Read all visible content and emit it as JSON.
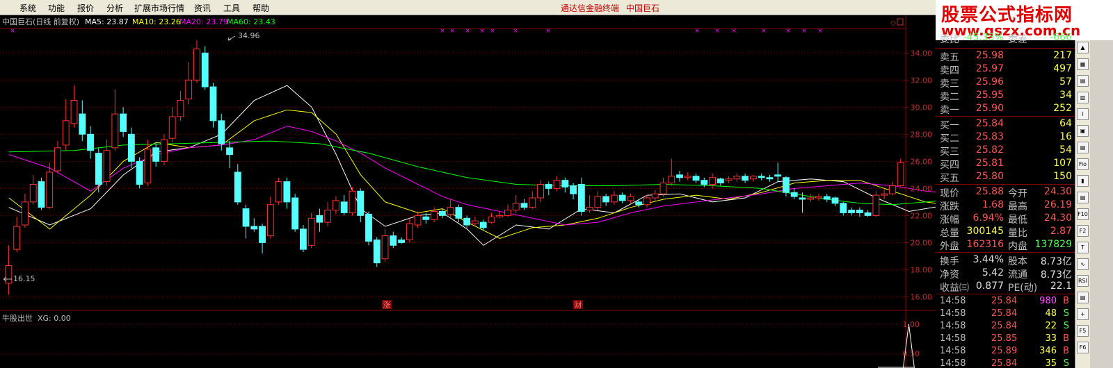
{
  "menu": {
    "items": [
      "系统",
      "功能",
      "报价",
      "分析",
      "扩展市场行情",
      "资讯",
      "工具",
      "帮助"
    ],
    "app_title": "通达信金融终端",
    "stock_title": "中国巨石"
  },
  "watermark": {
    "main": "股票公式指标网",
    "url": "www.gszx.com.cn"
  },
  "main_chart": {
    "header": {
      "name": "中国巨石(日线 前复权)",
      "ma5": "MA5: 23.87",
      "ma10": "MA10: 23.26",
      "ma20": "MA20: 23.79",
      "ma60": "MA60: 23.43"
    },
    "high_label": "34.96",
    "low_label": "16.15",
    "event_markers": [
      "涨",
      "财"
    ],
    "colors": {
      "up": "#ff3232",
      "down": "#54ffff",
      "ma5": "#ffffff",
      "ma10": "#ffff00",
      "ma20": "#ff00ff",
      "ma60": "#00ff00",
      "grid": "#8b0000",
      "axis_text": "#c03030"
    }
  },
  "indicator": {
    "title": "牛股出世",
    "value": "XG: 0.00",
    "axis": [
      "1.00",
      "0.50"
    ]
  },
  "chart_data": {
    "type": "candlestick",
    "title": "中国巨石(日线 前复权)",
    "y_ticks": [
      16.0,
      18.0,
      20.0,
      22.0,
      24.0,
      26.0,
      28.0,
      30.0,
      32.0,
      34.0
    ],
    "y_tick_labels": [
      "16.00",
      "18.00",
      "20.00",
      "22.00",
      "24.00",
      "26.00",
      "28.00",
      "30.00",
      "32.00",
      "34.00"
    ],
    "ylim": [
      15.2,
      35.4
    ],
    "candles": [
      [
        17.0,
        18.3,
        16.15,
        19.8
      ],
      [
        19.5,
        21.2,
        19.3,
        21.9
      ],
      [
        21.3,
        23.0,
        21.1,
        23.6
      ],
      [
        23.0,
        24.3,
        22.8,
        25.0
      ],
      [
        24.5,
        22.6,
        22.4,
        24.8
      ],
      [
        22.6,
        25.2,
        22.5,
        25.9
      ],
      [
        25.3,
        27.0,
        25.1,
        27.5
      ],
      [
        27.2,
        29.0,
        26.8,
        30.6
      ],
      [
        28.8,
        30.5,
        28.5,
        31.6
      ],
      [
        29.5,
        28.0,
        27.5,
        30.5
      ],
      [
        28.0,
        26.8,
        26.2,
        28.6
      ],
      [
        26.6,
        24.3,
        23.7,
        27.0
      ],
      [
        24.5,
        26.8,
        24.2,
        27.6
      ],
      [
        27.0,
        29.5,
        26.8,
        31.3
      ],
      [
        29.5,
        28.2,
        27.8,
        30.0
      ],
      [
        28.0,
        26.0,
        25.5,
        28.5
      ],
      [
        26.0,
        24.3,
        24.0,
        26.3
      ],
      [
        24.4,
        26.9,
        24.2,
        27.6
      ],
      [
        27.0,
        26.0,
        25.6,
        27.4
      ],
      [
        26.0,
        27.6,
        25.7,
        28.0
      ],
      [
        27.7,
        29.3,
        27.4,
        30.0
      ],
      [
        29.3,
        30.5,
        29.0,
        31.2
      ],
      [
        30.6,
        32.0,
        30.2,
        33.3
      ],
      [
        32.0,
        34.3,
        31.8,
        34.96
      ],
      [
        34.0,
        31.5,
        31.3,
        34.5
      ],
      [
        31.5,
        29.0,
        28.5,
        31.8
      ],
      [
        29.0,
        27.3,
        26.8,
        29.5
      ],
      [
        27.0,
        26.5,
        25.5,
        27.5
      ],
      [
        25.2,
        23.0,
        22.8,
        25.8
      ],
      [
        22.5,
        21.2,
        20.3,
        22.8
      ],
      [
        21.2,
        21.0,
        20.8,
        21.8
      ],
      [
        21.2,
        20.0,
        19.2,
        21.4
      ],
      [
        20.5,
        22.8,
        20.3,
        23.4
      ],
      [
        23.0,
        24.5,
        22.8,
        24.8
      ],
      [
        24.5,
        23.0,
        22.5,
        24.8
      ],
      [
        23.3,
        21.0,
        20.8,
        23.6
      ],
      [
        21.0,
        19.5,
        19.3,
        21.3
      ],
      [
        19.8,
        21.8,
        19.6,
        22.2
      ],
      [
        22.0,
        21.5,
        20.8,
        22.5
      ],
      [
        21.5,
        22.4,
        21.2,
        23.0
      ],
      [
        22.4,
        23.1,
        22.1,
        23.4
      ],
      [
        23.0,
        22.2,
        22.0,
        23.5
      ],
      [
        22.2,
        23.8,
        22.0,
        24.1
      ],
      [
        23.8,
        22.0,
        21.5,
        24.0
      ],
      [
        22.1,
        20.1,
        19.8,
        22.3
      ],
      [
        20.2,
        18.5,
        18.2,
        20.4
      ],
      [
        18.8,
        20.5,
        18.6,
        21.0
      ],
      [
        20.5,
        19.8,
        19.6,
        20.8
      ],
      [
        20.2,
        20.0,
        19.9,
        20.4
      ],
      [
        20.2,
        21.4,
        20.0,
        21.8
      ],
      [
        21.3,
        22.0,
        21.1,
        22.3
      ],
      [
        21.9,
        21.7,
        21.4,
        22.2
      ],
      [
        21.7,
        22.3,
        21.5,
        22.6
      ],
      [
        22.3,
        22.0,
        21.8,
        22.5
      ],
      [
        22.1,
        22.6,
        21.9,
        23.2
      ],
      [
        22.6,
        21.8,
        21.5,
        22.8
      ],
      [
        21.8,
        21.3,
        21.1,
        22.0
      ],
      [
        21.4,
        21.6,
        21.2,
        21.9
      ],
      [
        21.5,
        21.1,
        20.9,
        21.7
      ],
      [
        21.5,
        21.9,
        21.4,
        22.2
      ],
      [
        21.9,
        22.0,
        21.8,
        22.3
      ],
      [
        22.0,
        22.4,
        21.9,
        22.8
      ],
      [
        22.4,
        22.9,
        22.2,
        23.5
      ],
      [
        22.9,
        22.6,
        22.4,
        23.2
      ],
      [
        22.6,
        23.3,
        22.5,
        23.8
      ],
      [
        23.3,
        24.3,
        23.0,
        24.6
      ],
      [
        24.3,
        24.0,
        23.5,
        24.5
      ],
      [
        24.0,
        24.6,
        23.8,
        24.9
      ],
      [
        24.6,
        24.1,
        23.7,
        24.8
      ],
      [
        24.2,
        23.6,
        23.2,
        24.4
      ],
      [
        24.3,
        22.3,
        22.0,
        24.8
      ],
      [
        22.4,
        22.6,
        22.2,
        23.5
      ],
      [
        22.6,
        23.4,
        22.4,
        23.8
      ],
      [
        23.4,
        23.0,
        22.7,
        23.6
      ],
      [
        23.0,
        23.5,
        22.8,
        23.8
      ],
      [
        23.5,
        23.1,
        22.9,
        23.7
      ],
      [
        23.1,
        23.4,
        22.9,
        23.6
      ],
      [
        23.0,
        22.8,
        22.6,
        23.2
      ],
      [
        22.8,
        23.3,
        22.6,
        23.5
      ],
      [
        23.3,
        23.6,
        23.1,
        23.9
      ],
      [
        23.6,
        24.4,
        23.4,
        24.8
      ],
      [
        24.4,
        24.9,
        24.2,
        26.2
      ],
      [
        25.0,
        24.8,
        24.5,
        25.3
      ],
      [
        24.8,
        24.9,
        24.6,
        25.2
      ],
      [
        24.9,
        24.6,
        24.4,
        25.1
      ],
      [
        24.6,
        24.3,
        24.1,
        24.8
      ],
      [
        24.3,
        24.8,
        24.0,
        25.1
      ],
      [
        24.7,
        24.4,
        24.2,
        24.8
      ],
      [
        24.6,
        24.7,
        24.4,
        24.9
      ],
      [
        24.7,
        24.9,
        24.5,
        25.1
      ],
      [
        24.9,
        24.6,
        24.4,
        25.1
      ],
      [
        24.7,
        24.9,
        24.5,
        25.0
      ],
      [
        24.9,
        24.8,
        24.6,
        25.1
      ],
      [
        24.8,
        24.7,
        24.5,
        25.0
      ],
      [
        25.0,
        24.9,
        24.5,
        25.9
      ],
      [
        24.8,
        23.7,
        23.4,
        24.9
      ],
      [
        23.7,
        23.4,
        23.2,
        24.0
      ],
      [
        23.3,
        23.2,
        22.2,
        23.7
      ],
      [
        23.2,
        23.3,
        23.0,
        23.6
      ],
      [
        23.3,
        23.4,
        23.1,
        23.6
      ],
      [
        23.4,
        23.2,
        23.0,
        23.6
      ],
      [
        23.3,
        22.9,
        22.7,
        23.4
      ],
      [
        22.9,
        22.2,
        22.0,
        23.0
      ],
      [
        22.4,
        22.2,
        22.0,
        22.6
      ],
      [
        22.4,
        22.2,
        21.9,
        22.6
      ],
      [
        22.2,
        22.0,
        21.9,
        22.4
      ],
      [
        22.0,
        23.5,
        21.9,
        23.8
      ],
      [
        23.5,
        23.6,
        23.2,
        24.0
      ],
      [
        23.6,
        24.2,
        23.5,
        24.5
      ],
      [
        24.2,
        25.9,
        24.1,
        26.19
      ]
    ],
    "ma_series": [
      {
        "name": "MA5",
        "color": "#ffffff",
        "points": [
          [
            0,
            22.6
          ],
          [
            5,
            21.3
          ],
          [
            10,
            22.5
          ],
          [
            14,
            25.0
          ],
          [
            18,
            26.7
          ],
          [
            22,
            27.0
          ],
          [
            26,
            28.0
          ],
          [
            30,
            30.5
          ],
          [
            34,
            31.6
          ],
          [
            37,
            30.0
          ],
          [
            40,
            26.5
          ],
          [
            43,
            22.5
          ],
          [
            46,
            21.2
          ],
          [
            50,
            22.0
          ],
          [
            53,
            22.2
          ],
          [
            56,
            21.0
          ],
          [
            58,
            19.8
          ],
          [
            62,
            21.3
          ],
          [
            66,
            21.0
          ],
          [
            70,
            22.5
          ],
          [
            74,
            22.2
          ],
          [
            78,
            23.5
          ],
          [
            82,
            23.6
          ],
          [
            86,
            23.0
          ],
          [
            90,
            23.3
          ],
          [
            94,
            24.5
          ],
          [
            98,
            24.7
          ],
          [
            102,
            24.5
          ],
          [
            106,
            23.3
          ],
          [
            110,
            22.3
          ],
          [
            114,
            22.7
          ],
          [
            118,
            23.1
          ]
        ]
      },
      {
        "name": "MA10",
        "color": "#ffff00",
        "points": [
          [
            0,
            23.3
          ],
          [
            5,
            21.0
          ],
          [
            10,
            23.5
          ],
          [
            14,
            26.0
          ],
          [
            18,
            27.4
          ],
          [
            22,
            27.0
          ],
          [
            26,
            27.2
          ],
          [
            30,
            29.0
          ],
          [
            34,
            29.8
          ],
          [
            37,
            29.6
          ],
          [
            40,
            28.0
          ],
          [
            43,
            25.0
          ],
          [
            46,
            23.0
          ],
          [
            50,
            22.2
          ],
          [
            53,
            22.5
          ],
          [
            56,
            21.5
          ],
          [
            60,
            20.3
          ],
          [
            64,
            21.1
          ],
          [
            68,
            21.3
          ],
          [
            72,
            21.8
          ],
          [
            76,
            22.6
          ],
          [
            80,
            23.2
          ],
          [
            84,
            23.5
          ],
          [
            88,
            23.2
          ],
          [
            92,
            23.7
          ],
          [
            96,
            24.4
          ],
          [
            100,
            24.6
          ],
          [
            104,
            24.6
          ],
          [
            108,
            23.8
          ],
          [
            112,
            23.0
          ],
          [
            116,
            22.7
          ],
          [
            118,
            23.26
          ]
        ]
      },
      {
        "name": "MA20",
        "color": "#ff00ff",
        "points": [
          [
            0,
            26.5
          ],
          [
            5,
            25.5
          ],
          [
            10,
            23.8
          ],
          [
            14,
            25.5
          ],
          [
            18,
            26.5
          ],
          [
            22,
            27.0
          ],
          [
            26,
            27.2
          ],
          [
            30,
            27.6
          ],
          [
            34,
            28.6
          ],
          [
            37,
            28.2
          ],
          [
            40,
            27.5
          ],
          [
            43,
            26.6
          ],
          [
            46,
            25.5
          ],
          [
            50,
            24.3
          ],
          [
            53,
            23.4
          ],
          [
            56,
            22.8
          ],
          [
            60,
            22.3
          ],
          [
            64,
            21.8
          ],
          [
            68,
            21.3
          ],
          [
            72,
            21.5
          ],
          [
            76,
            22.2
          ],
          [
            80,
            22.7
          ],
          [
            84,
            23.0
          ],
          [
            88,
            23.3
          ],
          [
            92,
            23.6
          ],
          [
            96,
            24.0
          ],
          [
            100,
            24.2
          ],
          [
            104,
            24.4
          ],
          [
            108,
            24.2
          ],
          [
            112,
            23.8
          ],
          [
            116,
            23.6
          ],
          [
            118,
            23.79
          ]
        ]
      },
      {
        "name": "MA60",
        "color": "#00ff00",
        "points": [
          [
            0,
            26.7
          ],
          [
            8,
            26.8
          ],
          [
            14,
            27.2
          ],
          [
            20,
            27.3
          ],
          [
            26,
            27.4
          ],
          [
            32,
            27.5
          ],
          [
            38,
            27.3
          ],
          [
            44,
            26.6
          ],
          [
            50,
            25.6
          ],
          [
            56,
            24.8
          ],
          [
            62,
            24.3
          ],
          [
            68,
            24.2
          ],
          [
            74,
            24.2
          ],
          [
            80,
            24.3
          ],
          [
            86,
            24.2
          ],
          [
            92,
            24.0
          ],
          [
            96,
            23.6
          ],
          [
            100,
            23.2
          ],
          [
            104,
            22.9
          ],
          [
            108,
            22.8
          ],
          [
            112,
            23.0
          ],
          [
            116,
            23.2
          ],
          [
            118,
            23.43
          ]
        ]
      }
    ],
    "indicator_spike": {
      "name": "XG",
      "index": 110,
      "value": 1.0
    }
  },
  "quote": {
    "top_partial": [
      "委比",
      "-45.33%",
      "委差",
      "-666"
    ],
    "asks": [
      [
        "卖五",
        "25.98",
        "217"
      ],
      [
        "卖四",
        "25.97",
        "497"
      ],
      [
        "卖三",
        "25.96",
        "57"
      ],
      [
        "卖二",
        "25.95",
        "34"
      ],
      [
        "卖一",
        "25.90",
        "252"
      ]
    ],
    "bids": [
      [
        "买一",
        "25.84",
        "64"
      ],
      [
        "买二",
        "25.83",
        "16"
      ],
      [
        "买三",
        "25.82",
        "54"
      ],
      [
        "买四",
        "25.81",
        "107"
      ],
      [
        "买五",
        "25.80",
        "150"
      ]
    ],
    "stats": [
      [
        "现价",
        "25.88",
        "今开",
        "24.30"
      ],
      [
        "涨跌",
        "1.68",
        "最高",
        "26.19"
      ],
      [
        "涨幅",
        "6.94%",
        "最低",
        "24.30"
      ],
      [
        "总量",
        "300145",
        "量比",
        "2.87"
      ],
      [
        "外盘",
        "162316",
        "内盘",
        "137829"
      ]
    ],
    "fundamentals": [
      [
        "换手",
        "3.44%",
        "股本",
        "8.73亿"
      ],
      [
        "净资",
        "5.42",
        "流通",
        "8.73亿"
      ],
      [
        "收益㈢",
        "0.877",
        "PE(动)",
        "22.1"
      ]
    ],
    "ticks": [
      [
        "14:58",
        "25.84",
        "980",
        "B"
      ],
      [
        "14:58",
        "25.84",
        "48",
        "S"
      ],
      [
        "14:58",
        "25.84",
        "22",
        "S"
      ],
      [
        "14:58",
        "25.85",
        "33",
        "B"
      ],
      [
        "14:58",
        "25.89",
        "346",
        "B"
      ],
      [
        "14:58",
        "25.84",
        "35",
        "S"
      ]
    ]
  },
  "toolbar_icons": [
    "scroll-up-icon",
    "grid-icon",
    "book-icon",
    "list-icon",
    "chart-line-icon",
    "calendar-icon",
    "table-icon",
    "fio-icon",
    "chart-bar-icon",
    "book2-icon",
    "f10-icon",
    "f2-icon",
    "t-icon",
    "wave-icon",
    "rsi-icon",
    "doc-icon",
    "plus-icon",
    "f5-icon",
    "f6-icon"
  ]
}
